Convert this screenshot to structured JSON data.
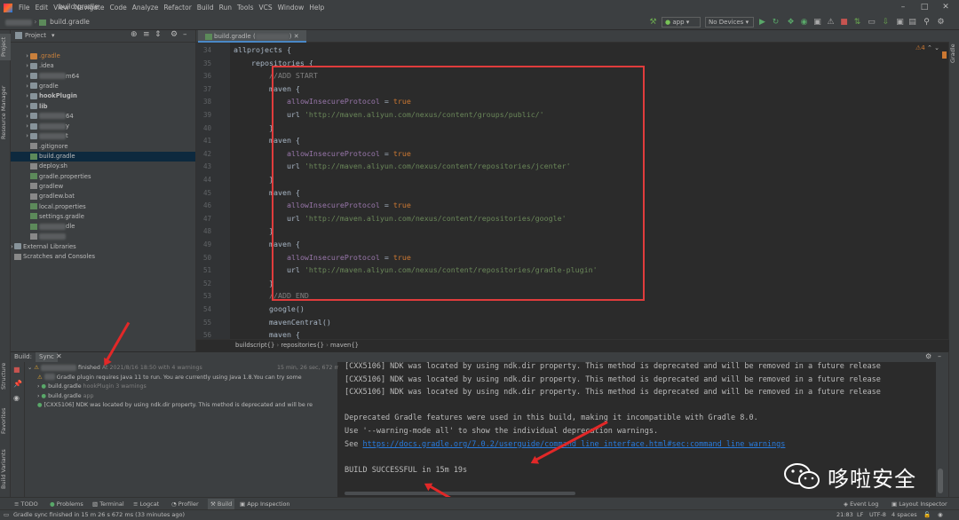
{
  "menu": {
    "items": [
      "File",
      "Edit",
      "View",
      "Navigate",
      "Code",
      "Analyze",
      "Refactor",
      "Build",
      "Run",
      "Tools",
      "VCS",
      "Window",
      "Help"
    ],
    "title_file": "build.gradle"
  },
  "navbar": {
    "crumb": "build.gradle",
    "run_config": "app",
    "device": "No Devices"
  },
  "project_panel": {
    "title": "Project",
    "items": [
      {
        "label": ".gradle",
        "type": "folder-orange",
        "indent": 1,
        "expandable": true
      },
      {
        "label": ".idea",
        "type": "folder",
        "indent": 1,
        "expandable": true
      },
      {
        "label": "m64",
        "type": "folder",
        "indent": 1,
        "expandable": true,
        "blurred": true
      },
      {
        "label": "gradle",
        "type": "folder",
        "indent": 1,
        "expandable": true
      },
      {
        "label": "hookPlugin",
        "type": "folder",
        "indent": 1,
        "expandable": true,
        "bold": true
      },
      {
        "label": "lib",
        "type": "folder",
        "indent": 1,
        "expandable": true,
        "bold": true
      },
      {
        "label": "64",
        "type": "folder",
        "indent": 1,
        "expandable": true,
        "blurred": true
      },
      {
        "label": "y",
        "type": "folder",
        "indent": 1,
        "expandable": true,
        "blurred": true
      },
      {
        "label": "t",
        "type": "folder",
        "indent": 1,
        "expandable": true,
        "blurred": true
      },
      {
        "label": ".gitignore",
        "type": "file-t",
        "indent": 1
      },
      {
        "label": "build.gradle",
        "type": "file-g",
        "indent": 1,
        "selected": true
      },
      {
        "label": "deploy.sh",
        "type": "file-t",
        "indent": 1
      },
      {
        "label": "gradle.properties",
        "type": "file-g",
        "indent": 1
      },
      {
        "label": "gradlew",
        "type": "file-t",
        "indent": 1
      },
      {
        "label": "gradlew.bat",
        "type": "file-t",
        "indent": 1
      },
      {
        "label": "local.properties",
        "type": "file-g",
        "indent": 1
      },
      {
        "label": "settings.gradle",
        "type": "file-g",
        "indent": 1
      },
      {
        "label": "dle",
        "type": "file-g",
        "indent": 1,
        "blurred": true
      },
      {
        "label": "",
        "type": "file-t",
        "indent": 1,
        "blurred": true
      },
      {
        "label": "External Libraries",
        "type": "lib",
        "indent": 0,
        "expandable": true
      },
      {
        "label": "Scratches and Consoles",
        "type": "scratch",
        "indent": 0
      }
    ]
  },
  "editor": {
    "tab": "build.gradle",
    "inspection_count": "4",
    "lines": [
      {
        "n": "34",
        "code": "allprojects {"
      },
      {
        "n": "35",
        "code": "    repositories {"
      },
      {
        "n": "36",
        "code": "        //ADD START"
      },
      {
        "n": "37",
        "code": "        maven {"
      },
      {
        "n": "38",
        "code": "            allowInsecureProtocol = true"
      },
      {
        "n": "39",
        "code": "            url 'http://maven.aliyun.com/nexus/content/groups/public/'"
      },
      {
        "n": "40",
        "code": "        }"
      },
      {
        "n": "41",
        "code": "        maven {"
      },
      {
        "n": "42",
        "code": "            allowInsecureProtocol = true"
      },
      {
        "n": "43",
        "code": "            url 'http://maven.aliyun.com/nexus/content/repositories/jcenter'"
      },
      {
        "n": "44",
        "code": "        }"
      },
      {
        "n": "45",
        "code": "        maven {"
      },
      {
        "n": "46",
        "code": "            allowInsecureProtocol = true"
      },
      {
        "n": "47",
        "code": "            url 'http://maven.aliyun.com/nexus/content/repositories/google'"
      },
      {
        "n": "48",
        "code": "        }"
      },
      {
        "n": "49",
        "code": "        maven {"
      },
      {
        "n": "50",
        "code": "            allowInsecureProtocol = true"
      },
      {
        "n": "51",
        "code": "            url 'http://maven.aliyun.com/nexus/content/repositories/gradle-plugin'"
      },
      {
        "n": "52",
        "code": "        }"
      },
      {
        "n": "53",
        "code": "        //ADD END"
      },
      {
        "n": "54",
        "code": "        google()"
      },
      {
        "n": "55",
        "code": "        mavenCentral()"
      },
      {
        "n": "56",
        "code": "        maven {"
      }
    ],
    "breadcrumbs": [
      "buildscript{}",
      "repositories{}",
      "maven{}"
    ]
  },
  "build": {
    "tab_build": "Build:",
    "tab_sync": "Sync",
    "rows": [
      {
        "text": "finished",
        "extra": "At 2021/8/16 18:50 with 4 warnings",
        "time": "15 min, 26 sec, 672 ms",
        "level": 0
      },
      {
        "text": "Gradle plugin requires Java 11 to run. You are currently using Java 1.8.You can try some",
        "level": 1
      },
      {
        "text": "build.gradle",
        "extra": "hookPlugin 3 warnings",
        "level": 1
      },
      {
        "text": "build.gradle",
        "extra": "app",
        "level": 1
      },
      {
        "text": "[CXX5106] NDK was located by using ndk.dir property. This method is deprecated and will be re",
        "level": 1
      }
    ],
    "console": {
      "ndk_lines": [
        "[CXX5106] NDK was located by using ndk.dir property. This method is deprecated and will be removed in a future release",
        "[CXX5106] NDK was located by using ndk.dir property. This method is deprecated and will be removed in a future release",
        "[CXX5106] NDK was located by using ndk.dir property. This method is deprecated and will be removed in a future release"
      ],
      "deprecated": "Deprecated Gradle features were used in this build, making it incompatible with Gradle 8.0.",
      "use_warning": "Use '--warning-mode all' to show the individual deprecation warnings.",
      "see_prefix": "See ",
      "see_link": "https://docs.gradle.org/7.0.2/userguide/command_line_interface.html#sec:command_line_warnings",
      "result": "BUILD SUCCESSFUL in 15m 19s"
    }
  },
  "tool_tabs": {
    "todo": "TODO",
    "problems": "Problems",
    "terminal": "Terminal",
    "logcat": "Logcat",
    "profiler": "Profiler",
    "build": "Build",
    "app_inspection": "App Inspection",
    "event_log": "Event Log",
    "layout_inspector": "Layout Inspector"
  },
  "status": {
    "message": "Gradle sync finished in 15 m 26 s 672 ms (33 minutes ago)",
    "position": "21:83",
    "line_sep": "LF",
    "encoding": "UTF-8",
    "indent": "4 spaces"
  },
  "stripes": {
    "project": "Project",
    "resource_manager": "Resource Manager",
    "structure": "Structure",
    "favorites": "Favorites",
    "build_variants": "Build Variants",
    "gradle": "Gradle"
  },
  "watermark": {
    "text": "哆啦安全"
  },
  "colors": {
    "accent_red": "#e03c3c",
    "keyword": "#cc7832",
    "string": "#6a8759",
    "property": "#9876aa",
    "link": "#287bde"
  }
}
